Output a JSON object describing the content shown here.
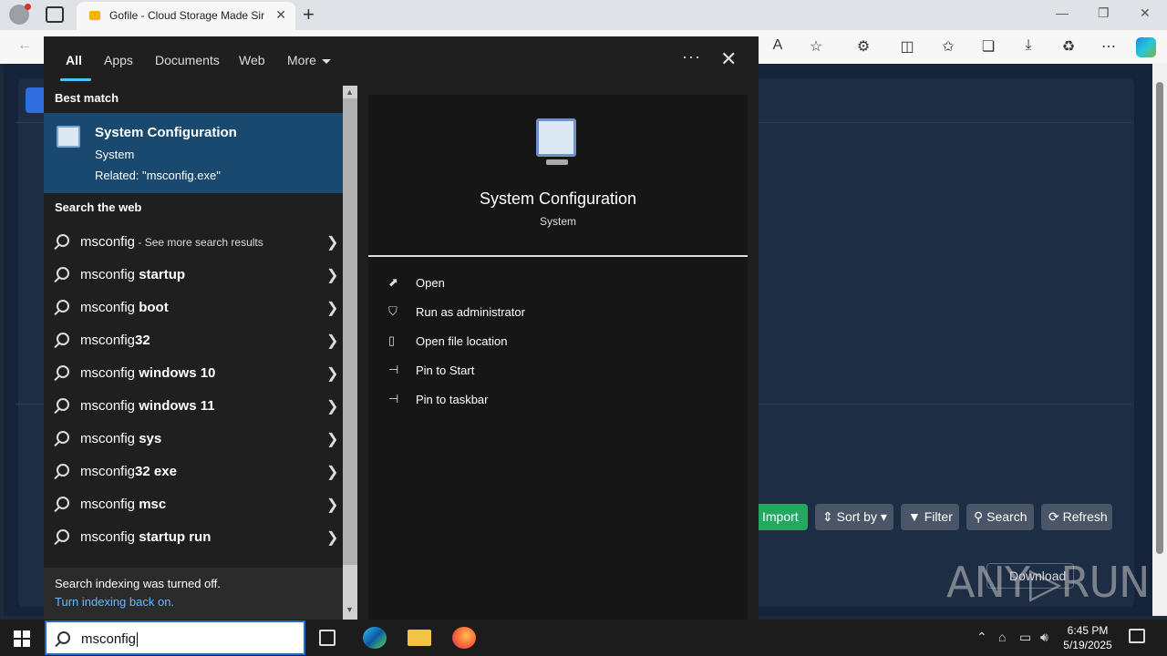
{
  "browser": {
    "tab_title": "Gofile - Cloud Storage Made Simple",
    "tab_close": "✕",
    "new_tab": "+",
    "win_min": "—",
    "win_restore": "❐",
    "win_close": "✕"
  },
  "page": {
    "buttons": {
      "import": "Import",
      "sort_by": "⇕ Sort by ▾",
      "filter": "▼ Filter",
      "search": "⚲ Search",
      "refresh": "⟳ Refresh",
      "download": "Download"
    },
    "watermark": "ANY▷RUN"
  },
  "search": {
    "tabs": [
      "All",
      "Apps",
      "Documents",
      "Web",
      "More"
    ],
    "more_options": "···",
    "close": "✕",
    "best_match_heading": "Best match",
    "best_match": {
      "name": "System Configuration",
      "type": "System",
      "related": "Related: \"msconfig.exe\""
    },
    "web_heading": "Search the web",
    "web_results": [
      {
        "prefix": "msconfig",
        "bold": "",
        "suffix": " - See more search results"
      },
      {
        "prefix": "msconfig ",
        "bold": "startup",
        "suffix": ""
      },
      {
        "prefix": "msconfig ",
        "bold": "boot",
        "suffix": ""
      },
      {
        "prefix": "msconfig",
        "bold": "32",
        "suffix": ""
      },
      {
        "prefix": "msconfig ",
        "bold": "windows 10",
        "suffix": ""
      },
      {
        "prefix": "msconfig ",
        "bold": "windows 11",
        "suffix": ""
      },
      {
        "prefix": "msconfig ",
        "bold": "sys",
        "suffix": ""
      },
      {
        "prefix": "msconfig",
        "bold": "32 exe",
        "suffix": ""
      },
      {
        "prefix": "msconfig ",
        "bold": "msc",
        "suffix": ""
      },
      {
        "prefix": "msconfig ",
        "bold": "startup run",
        "suffix": ""
      }
    ],
    "footer_note": "Search indexing was turned off.",
    "footer_link": "Turn indexing back on.",
    "detail": {
      "name": "System Configuration",
      "type": "System",
      "actions": [
        "Open",
        "Run as administrator",
        "Open file location",
        "Pin to Start",
        "Pin to taskbar"
      ]
    },
    "query": "msconfig"
  },
  "taskbar": {
    "time": "6:45 PM",
    "date": "5/19/2025"
  }
}
